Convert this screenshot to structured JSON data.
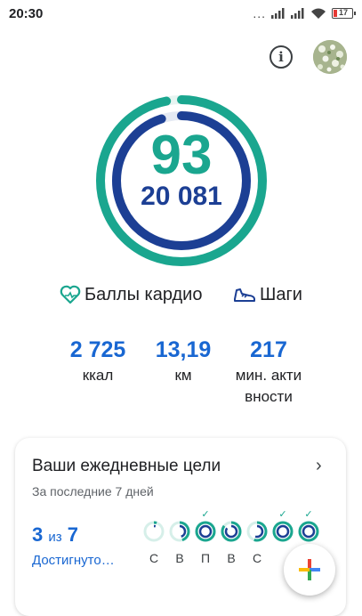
{
  "status_bar": {
    "time": "20:30",
    "battery": "17",
    "dots": "..."
  },
  "header": {
    "info_icon": "info-icon",
    "avatar_icon": "avatar-photo",
    "info_glyph": "i"
  },
  "summary": {
    "heart_points": "93",
    "steps": "20 081",
    "heart_progress": 0.97,
    "steps_progress": 0.95
  },
  "legend": {
    "cardio_label": "Баллы кардио",
    "cardio_icon": "heart-icon",
    "steps_label": "Шаги",
    "steps_icon": "shoe-icon"
  },
  "stats": [
    {
      "value": "2 725",
      "label": "ккал"
    },
    {
      "value": "13,19",
      "label": "км"
    },
    {
      "value": "217",
      "label_line1": "мин. акти",
      "label_line2": "вности"
    }
  ],
  "goals_card": {
    "title": "Ваши ежедневные цели",
    "subtitle": "За последние 7 дней",
    "achieved_count": "3",
    "achieved_of": "из",
    "achieved_total": "7",
    "achieved_label": "Достигнуто…",
    "chevron": "›",
    "days": [
      {
        "label": "С",
        "achieved": false,
        "progress": 0.05
      },
      {
        "label": "В",
        "achieved": false,
        "progress": 0.45
      },
      {
        "label": "П",
        "achieved": true,
        "progress": 1.0
      },
      {
        "label": "В",
        "achieved": false,
        "progress": 0.85
      },
      {
        "label": "С",
        "achieved": false,
        "progress": 0.55
      },
      {
        "label": "",
        "achieved": true,
        "progress": 1.0
      },
      {
        "label": "",
        "achieved": true,
        "progress": 1.0
      }
    ]
  },
  "fab": {
    "icon": "plus-icon",
    "colors": [
      "#ea4335",
      "#4285f4",
      "#34a853",
      "#fbbc05"
    ]
  },
  "colors": {
    "teal": "#1aa68f",
    "navy": "#1c3f94",
    "blue": "#1967d2"
  }
}
